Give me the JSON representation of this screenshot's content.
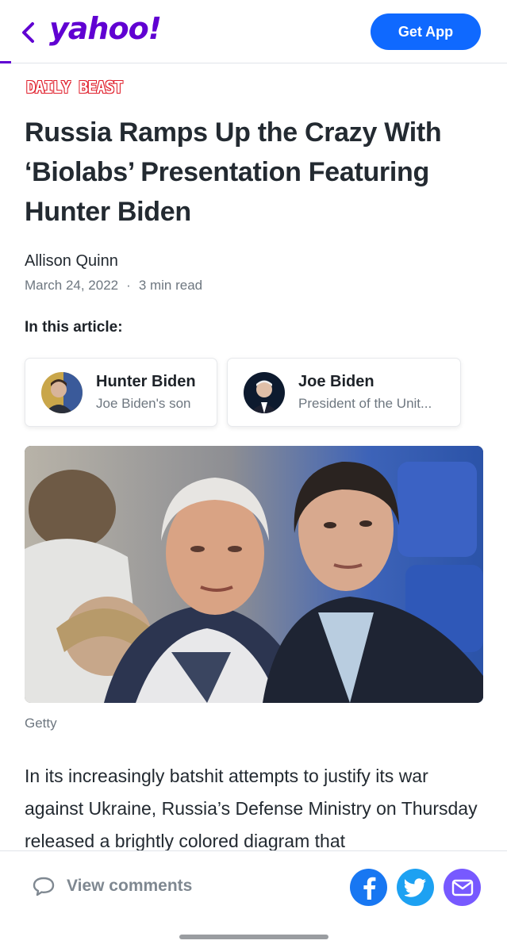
{
  "header": {
    "logo_text": "yahoo!",
    "get_app_label": "Get App",
    "accent_color": "#6001d2",
    "button_color": "#0f69ff"
  },
  "article": {
    "source": "DAILY BEAST",
    "headline": "Russia Ramps Up the Crazy With ‘Biolabs’ Presentation Featuring Hunter Biden",
    "author": "Allison Quinn",
    "date": "March 24, 2022",
    "read_time": "3 min read",
    "in_this_article_label": "In this article:",
    "entities": [
      {
        "name": "Hunter Biden",
        "description": "Joe Biden's son"
      },
      {
        "name": "Joe Biden",
        "description": "President of the Unit..."
      }
    ],
    "image_caption": "Getty",
    "body_text": "In its increasingly batshit attempts to justify its war against Ukraine, Russia’s Defense Ministry on Thursday released a brightly colored diagram that"
  },
  "footer": {
    "comments_label": "View comments",
    "share_icons": [
      "facebook-icon",
      "twitter-icon",
      "mail-icon"
    ],
    "share_colors": {
      "facebook": "#1877f2",
      "twitter": "#1da1f2",
      "mail": "#7759ff"
    }
  }
}
